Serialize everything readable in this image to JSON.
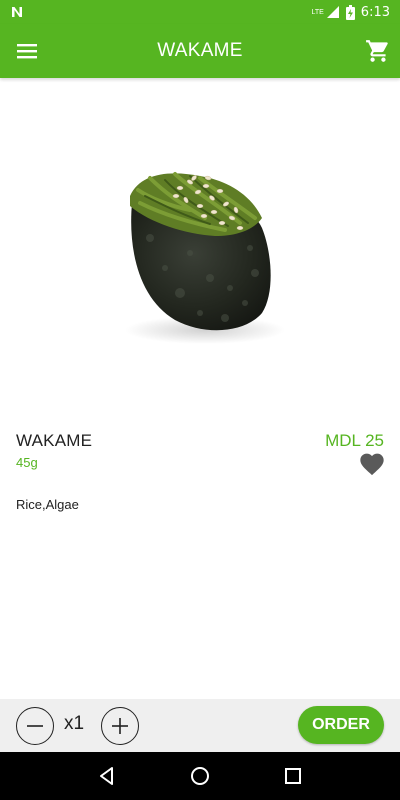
{
  "status_bar": {
    "network_label": "LTE",
    "time": "6:13",
    "icons": [
      "notification-n-icon",
      "signal-icon",
      "battery-icon"
    ]
  },
  "app_bar": {
    "title": "WAKAME",
    "icons": [
      "menu-icon",
      "cart-icon"
    ]
  },
  "product": {
    "name": "WAKAME",
    "weight": "45g",
    "price": "MDL 25",
    "ingredients": "Rice,Algae",
    "favorite_icon": "heart-icon"
  },
  "order_bar": {
    "quantity": "x1",
    "order_label": "ORDER",
    "icons": [
      "minus-icon",
      "plus-icon"
    ]
  },
  "nav_bar": {
    "icons": [
      "back-icon",
      "home-icon",
      "recents-icon"
    ]
  },
  "colors": {
    "brand_green": "#56b521",
    "bottom_bar_bg": "#efefef",
    "text_dark": "#222222"
  }
}
